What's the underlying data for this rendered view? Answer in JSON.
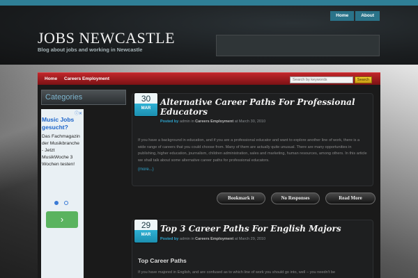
{
  "topnav": {
    "items": [
      "Home",
      "About"
    ]
  },
  "site": {
    "title": "JOBS NEWCASTLE",
    "description": "Blog about jobs and working in Newcastle"
  },
  "menu": {
    "items": [
      "Home",
      "Careers Employment"
    ]
  },
  "search": {
    "placeholder": "Search by keywords",
    "button_label": "Search"
  },
  "sidebar": {
    "heading": "Categories"
  },
  "ad": {
    "info_icon": "info-icon",
    "title": "Music Jobs gesucht?",
    "text": "Das Fachmagazin der Musikbranche - Jetzt MusikWoche 3 Wochen testen!",
    "cta_icon": "chevron-right-icon"
  },
  "posts": [
    {
      "day": "30",
      "month": "MAR",
      "title": "Alternative Career Paths For Professional Educators",
      "meta_posted_by": "Posted by",
      "meta_author": "admin",
      "meta_in": "in",
      "meta_category": "Careers Employment",
      "meta_at": "at March 30, 2010",
      "body": "If you have a background in education, and if you are a professional educator and want to explore another line of work, there is a wide range of careers that you could choose from. Many of them are actually quite unusual. There are many opportunities in publishing, higher education, journalism, children administration, sales and marketing, human resources, among others. In this article we shall talk about some alternative career paths for professional educators.",
      "more": "(more...)"
    },
    {
      "day": "29",
      "month": "MAR",
      "title": "Top 3 Career Paths For English Majors",
      "meta_posted_by": "Posted by",
      "meta_author": "admin",
      "meta_in": "in",
      "meta_category": "Careers Employment",
      "meta_at": "at March 29, 2010",
      "subheading": "Top Career Paths",
      "body": "If you have majored in English, and are confused as to which line of work you should go into, well – you needn't be"
    }
  ],
  "actions": {
    "bookmark": "Bookmark it",
    "responses": "No Responses",
    "read_more": "Read More"
  }
}
